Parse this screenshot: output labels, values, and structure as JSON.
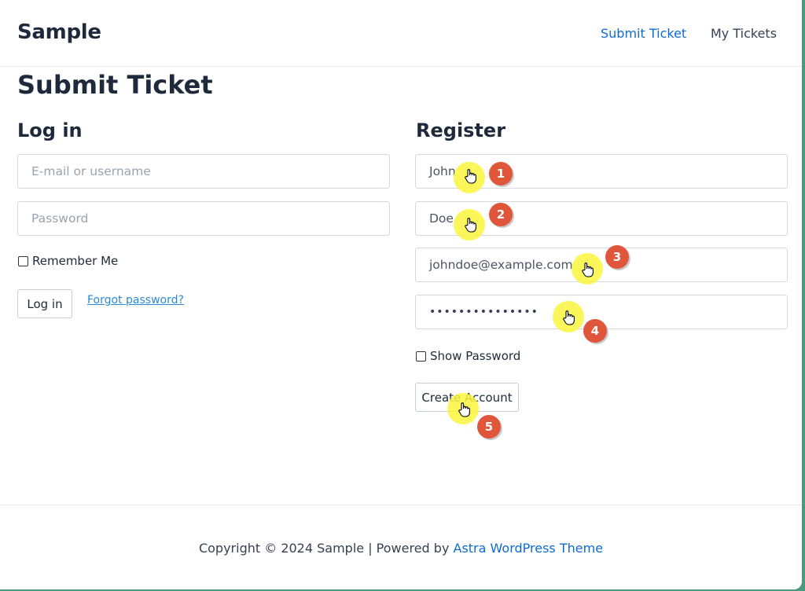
{
  "header": {
    "site_title": "Sample",
    "nav": [
      {
        "label": "Submit Ticket",
        "active": true
      },
      {
        "label": "My Tickets",
        "active": false
      }
    ]
  },
  "page": {
    "title": "Submit Ticket"
  },
  "login": {
    "heading": "Log in",
    "username_placeholder": "E-mail or username",
    "password_placeholder": "Password",
    "remember_label": "Remember Me",
    "remember_checked": false,
    "login_button": "Log in",
    "forgot_link": "Forgot password?"
  },
  "register": {
    "heading": "Register",
    "first_name_value": "John",
    "last_name_value": "Doe",
    "email_value": "johndoe@example.com",
    "password_mask": "•••••••••••••••",
    "show_password_label": "Show Password",
    "show_password_checked": false,
    "create_button": "Create Account"
  },
  "annotations": {
    "steps": [
      "1",
      "2",
      "3",
      "4",
      "5"
    ],
    "highlight_color": "#f8f03c",
    "step_color": "#e0563a"
  },
  "footer": {
    "copyright": "Copyright © 2024 Sample | Powered by ",
    "theme_link": "Astra WordPress Theme"
  },
  "colors": {
    "link": "#0d6bd0",
    "frame": "#4a9a7e"
  }
}
